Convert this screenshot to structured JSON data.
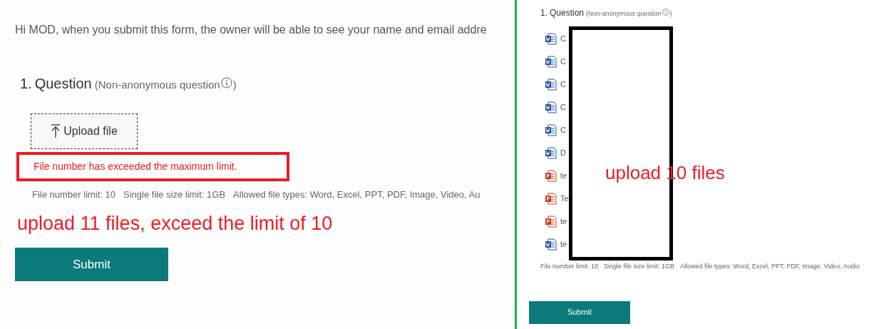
{
  "left_panel": {
    "greeting": "Hi MOD, when you submit this form, the owner will be able to see your name and email addre",
    "question": {
      "number": "1.",
      "title": "Question",
      "note": "(Non-anonymous question",
      "note_end": ")"
    },
    "upload_button": "Upload file",
    "error": "File number has exceeded the maximum limit.",
    "limits": [
      "File number limit: 10",
      "Single file size limit: 1GB",
      "Allowed file types: Word, Excel, PPT, PDF, Image, Video, Au"
    ],
    "annotation": "upload 11 files, exceed the limit of 10",
    "submit": "Submit"
  },
  "right_panel": {
    "question": {
      "number": "1.",
      "title": "Question",
      "note": "(Non-anonymous question",
      "note_end": ")"
    },
    "files": [
      {
        "kind": "word",
        "name": "C"
      },
      {
        "kind": "word",
        "name": "C"
      },
      {
        "kind": "word",
        "name": "C"
      },
      {
        "kind": "word",
        "name": "C"
      },
      {
        "kind": "word",
        "name": "C"
      },
      {
        "kind": "word",
        "name": "D"
      },
      {
        "kind": "ppt",
        "name": "te"
      },
      {
        "kind": "ppt",
        "name": "Te"
      },
      {
        "kind": "ppt",
        "name": "te"
      },
      {
        "kind": "word",
        "name": "te"
      }
    ],
    "limits": [
      "File number limit: 10",
      "Single file size limit: 1GB",
      "Allowed file types: Word, Excel, PPT, PDF, Image, Video, Audio"
    ],
    "annotation": "upload 10 files",
    "submit": "Submit"
  }
}
